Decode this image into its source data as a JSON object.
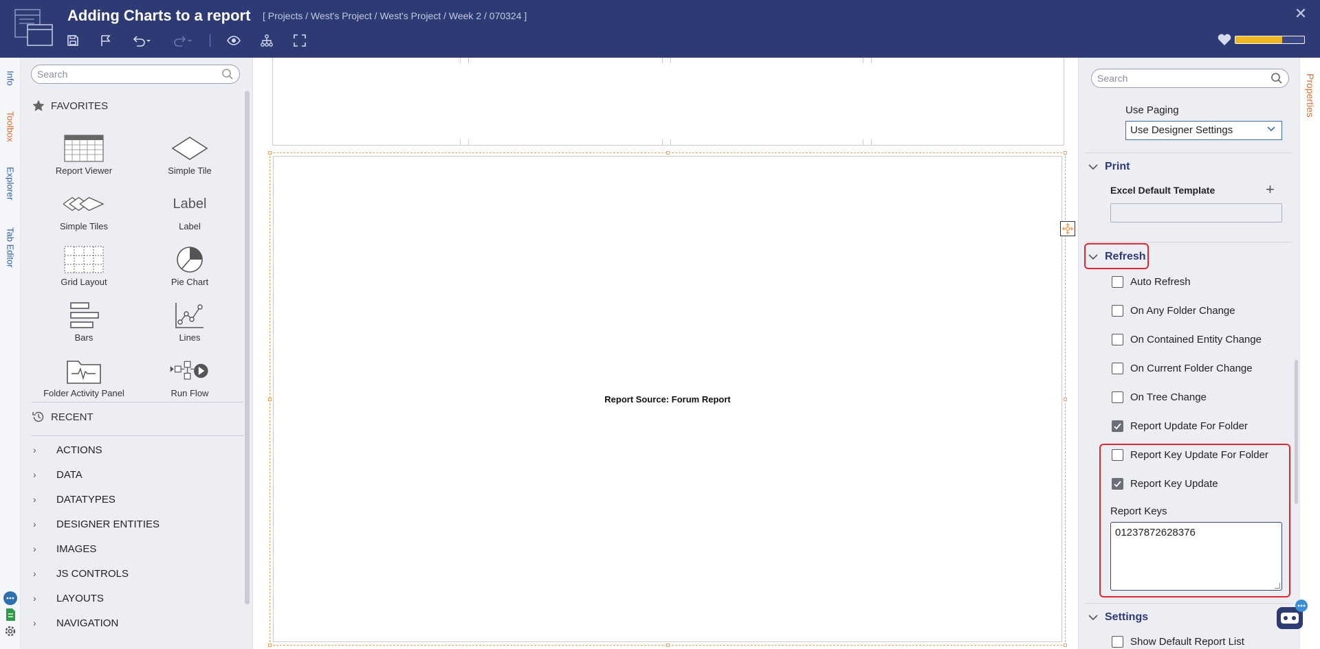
{
  "header": {
    "title": "Adding Charts to a report",
    "breadcrumb": "[ Projects / West's Project / West's Project / Week 2 / 070324 ]",
    "progress_fraction": 0.68,
    "accent": "#2e3a74",
    "progress_color": "#f0b820",
    "toolbar_icons": [
      "save-icon",
      "flag-icon",
      "undo-icon",
      "redo-icon",
      "preview-icon",
      "hierarchy-icon",
      "fullscreen-icon"
    ]
  },
  "left_tabs": [
    "Info",
    "Toolbox",
    "Explorer",
    "Tab Editor"
  ],
  "toolbox": {
    "search_placeholder": "Search",
    "favorites_label": "FAVORITES",
    "tools": [
      {
        "label": "Report Viewer",
        "icon": "table-icon"
      },
      {
        "label": "Simple Tile",
        "icon": "diamond-icon"
      },
      {
        "label": "Simple Tiles",
        "icon": "diamonds-icon"
      },
      {
        "label": "Label",
        "icon": "label-icon",
        "icon_text": "Label"
      },
      {
        "label": "Grid Layout",
        "icon": "grid-icon"
      },
      {
        "label": "Pie Chart",
        "icon": "pie-chart-icon"
      },
      {
        "label": "Bars",
        "icon": "bars-icon"
      },
      {
        "label": "Lines",
        "icon": "line-chart-icon"
      },
      {
        "label": "Folder Activity Panel",
        "icon": "folder-activity-icon"
      },
      {
        "label": "Run Flow",
        "icon": "run-flow-icon"
      }
    ],
    "recent_label": "RECENT",
    "categories": [
      "ACTIONS",
      "DATA",
      "DATATYPES",
      "DESIGNER ENTITIES",
      "IMAGES",
      "JS CONTROLS",
      "LAYOUTS",
      "NAVIGATION"
    ]
  },
  "canvas": {
    "report_source": "Report Source: Forum Report"
  },
  "properties": {
    "tab_label": "Properties",
    "search_placeholder": "Search",
    "use_paging_label": "Use Paging",
    "use_paging_value": "Use Designer Settings",
    "print_header": "Print",
    "excel_template_label": "Excel Default Template",
    "excel_template_value": "",
    "refresh_header": "Refresh",
    "checkboxes": [
      {
        "label": "Auto Refresh",
        "checked": false
      },
      {
        "label": "On Any Folder Change",
        "checked": false
      },
      {
        "label": "On Contained Entity Change",
        "checked": false
      },
      {
        "label": "On Current Folder Change",
        "checked": false
      },
      {
        "label": "On Tree Change",
        "checked": false
      },
      {
        "label": "Report Update For Folder",
        "checked": true
      },
      {
        "label": "Report Key Update For Folder",
        "checked": false
      },
      {
        "label": "Report Key Update",
        "checked": true
      }
    ],
    "report_keys_label": "Report Keys",
    "report_keys_value": "01237872628376",
    "settings_header": "Settings",
    "show_default_report_list": "Show Default Report List"
  }
}
